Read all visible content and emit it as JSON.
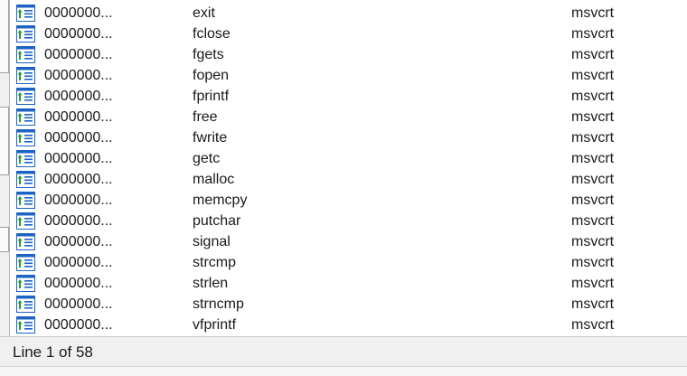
{
  "imports": {
    "rows": [
      {
        "address": "0000000...",
        "name": "exit",
        "library": "msvcrt"
      },
      {
        "address": "0000000...",
        "name": "fclose",
        "library": "msvcrt"
      },
      {
        "address": "0000000...",
        "name": "fgets",
        "library": "msvcrt"
      },
      {
        "address": "0000000...",
        "name": "fopen",
        "library": "msvcrt"
      },
      {
        "address": "0000000...",
        "name": "fprintf",
        "library": "msvcrt"
      },
      {
        "address": "0000000...",
        "name": "free",
        "library": "msvcrt"
      },
      {
        "address": "0000000...",
        "name": "fwrite",
        "library": "msvcrt"
      },
      {
        "address": "0000000...",
        "name": "getc",
        "library": "msvcrt"
      },
      {
        "address": "0000000...",
        "name": "malloc",
        "library": "msvcrt"
      },
      {
        "address": "0000000...",
        "name": "memcpy",
        "library": "msvcrt"
      },
      {
        "address": "0000000...",
        "name": "putchar",
        "library": "msvcrt"
      },
      {
        "address": "0000000...",
        "name": "signal",
        "library": "msvcrt"
      },
      {
        "address": "0000000...",
        "name": "strcmp",
        "library": "msvcrt"
      },
      {
        "address": "0000000...",
        "name": "strlen",
        "library": "msvcrt"
      },
      {
        "address": "0000000...",
        "name": "strncmp",
        "library": "msvcrt"
      },
      {
        "address": "0000000...",
        "name": "vfprintf",
        "library": "msvcrt"
      }
    ],
    "row_icon": "import-function-icon"
  },
  "status_bar": {
    "text": "Line 1 of 58"
  },
  "colors": {
    "icon_blue": "#1c63c4",
    "icon_green": "#2e9a2e",
    "status_bg": "#f0f0f0"
  }
}
